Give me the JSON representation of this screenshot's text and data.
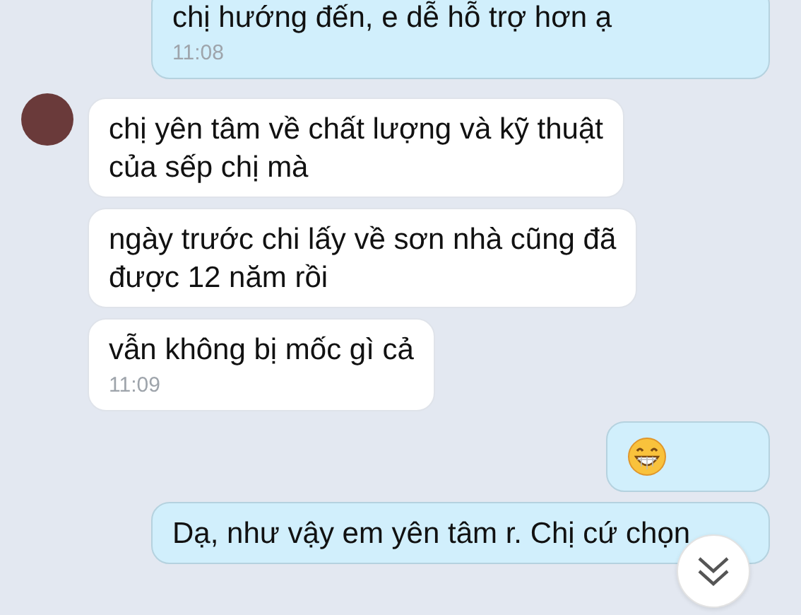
{
  "messages": [
    {
      "kind": "sent",
      "text": "chị hướng đến, e dễ hỗ trợ hơn ạ",
      "time": "11:08"
    },
    {
      "kind": "received",
      "avatar": true,
      "text": "chị yên tâm về chất lượng và kỹ thuật\ncủa sếp chị mà"
    },
    {
      "kind": "received",
      "avatar": false,
      "text": "ngày trước chi lấy về sơn nhà cũng đã\nđược 12 năm rồi"
    },
    {
      "kind": "received",
      "avatar": false,
      "text": "vẫn không bị mốc gì cả",
      "time": "11:09"
    },
    {
      "kind": "emoji"
    },
    {
      "kind": "sent",
      "text": "Dạ, như vậy em yên tâm r. Chị cứ chọn"
    }
  ]
}
